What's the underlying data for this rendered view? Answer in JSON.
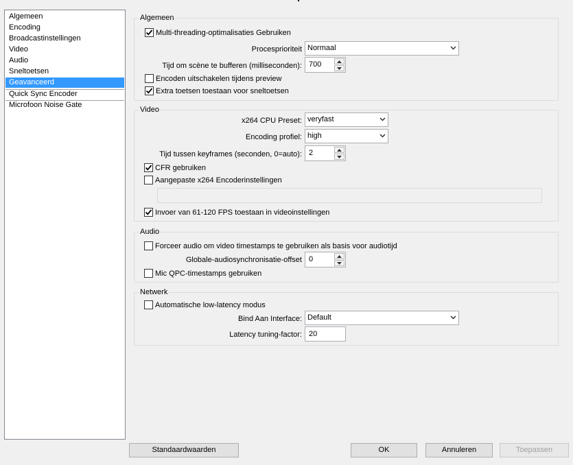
{
  "sidebar": {
    "items": [
      {
        "label": "Algemeen"
      },
      {
        "label": "Encoding"
      },
      {
        "label": "Broadcastinstellingen"
      },
      {
        "label": "Video"
      },
      {
        "label": "Audio"
      },
      {
        "label": "Sneltoetsen"
      },
      {
        "label": "Geavanceerd",
        "selected": true
      },
      {
        "label": "Quick Sync Encoder"
      },
      {
        "label": "Microfoon Noise Gate"
      }
    ]
  },
  "general": {
    "title": "Algemeen",
    "multithreading": {
      "label": "Multi-threading-optimalisaties Gebruiken",
      "checked": true
    },
    "process_priority": {
      "label": "Procesprioriteit",
      "value": "Normaal"
    },
    "scene_buffer": {
      "label": "Tijd om scène te bufferen (milliseconden):",
      "value": "700"
    },
    "disable_encode_preview": {
      "label": "Encoden uitschakelen tijdens preview",
      "checked": false
    },
    "extra_hotkeys": {
      "label": "Extra toetsen toestaan voor sneltoetsen",
      "checked": true
    }
  },
  "video": {
    "title": "Video",
    "cpu_preset": {
      "label": "x264 CPU Preset:",
      "value": "veryfast"
    },
    "encoding_profile": {
      "label": "Encoding profiel:",
      "value": "high"
    },
    "keyframes": {
      "label": "Tijd tussen keyframes (seconden, 0=auto):",
      "value": "2"
    },
    "cfr": {
      "label": "CFR gebruiken",
      "checked": true
    },
    "custom_x264": {
      "label": "Aangepaste x264 Encoderinstellingen",
      "checked": false,
      "value": ""
    },
    "fps_input": {
      "label": "Invoer van 61-120 FPS toestaan in videoinstellingen",
      "checked": true
    }
  },
  "audio": {
    "title": "Audio",
    "force_timestamps": {
      "label": "Forceer audio om video timestamps te gebruiken als basis voor audiotijd",
      "checked": false
    },
    "sync_offset": {
      "label": "Globale-audiosynchronisatie-offset",
      "value": "0"
    },
    "mic_qpc": {
      "label": "Mic QPC-timestamps gebruiken",
      "checked": false
    }
  },
  "network": {
    "title": "Netwerk",
    "low_latency": {
      "label": "Automatische low-latency modus",
      "checked": false
    },
    "bind_interface": {
      "label": "Bind Aan Interface:",
      "value": "Default"
    },
    "latency_factor": {
      "label": "Latency tuning-factor:",
      "value": "20"
    }
  },
  "buttons": {
    "defaults": "Standaardwaarden",
    "ok": "OK",
    "cancel": "Annuleren",
    "apply": "Toepassen"
  },
  "colors": {
    "selection": "#3399ff",
    "background": "#f0f0f0"
  }
}
